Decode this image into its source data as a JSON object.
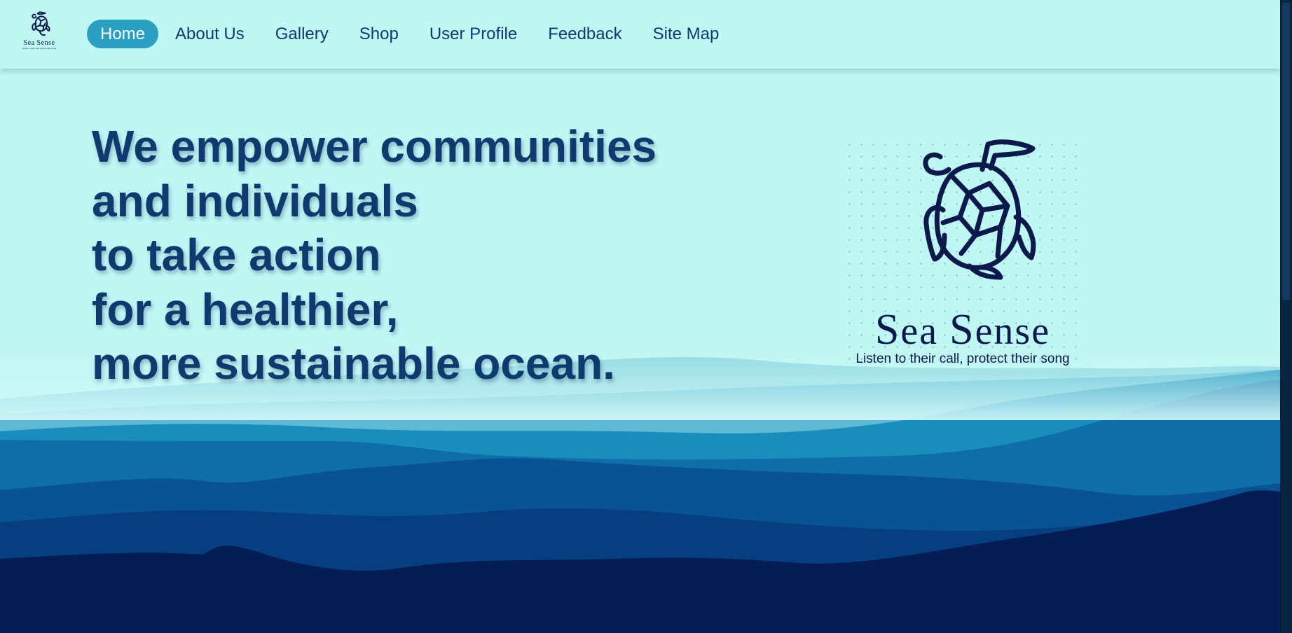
{
  "nav": {
    "logo": {
      "name": "Sea Sense",
      "tagline": "Listen to their call, protect their song"
    },
    "links": [
      {
        "label": "Home",
        "active": true
      },
      {
        "label": "About Us",
        "active": false
      },
      {
        "label": "Gallery",
        "active": false
      },
      {
        "label": "Shop",
        "active": false
      },
      {
        "label": "User Profile",
        "active": false
      },
      {
        "label": "Feedback",
        "active": false
      },
      {
        "label": "Site Map",
        "active": false
      }
    ]
  },
  "hero": {
    "headline": [
      "We empower communities",
      "and individuals",
      "to take action",
      "for a healthier,",
      "more sustainable ocean."
    ]
  },
  "brand": {
    "name_initial_1": "S",
    "name_rest_1": "ea ",
    "name_initial_2": "S",
    "name_rest_2": "ense",
    "tagline": "Listen to their call, protect their song"
  },
  "colors": {
    "background": "#bff7f5",
    "headline": "#0d3b6e",
    "active_nav": "#2b9fc2",
    "brand_ink": "#0b1a4a",
    "wave_light": "#6cc5d8",
    "wave_mid": "#1a86b8",
    "wave_deep": "#0a4f8a",
    "wave_darkest": "#041a4a"
  },
  "icons": {
    "logo": "turtle-icon"
  }
}
